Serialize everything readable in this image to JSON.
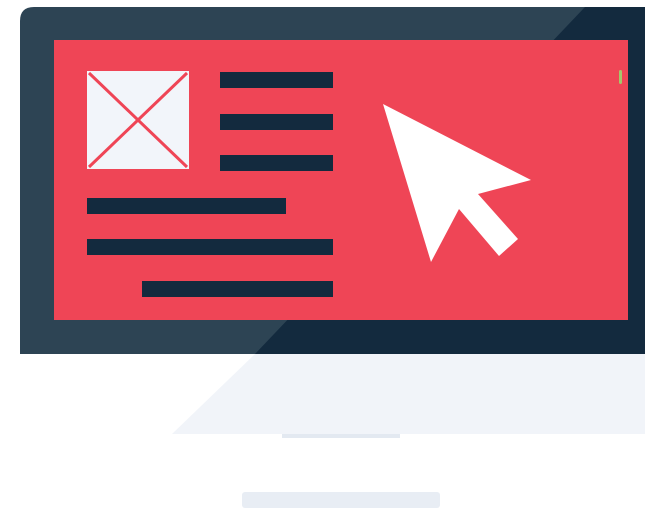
{
  "illustration": {
    "subject": "computer-monitor-with-cursor",
    "icons": {
      "image_placeholder": "image-placeholder-icon",
      "cursor": "mouse-pointer-icon"
    },
    "colors": {
      "bezel_left": "#2D4454",
      "bezel_right": "#132A3E",
      "screen": "#EF4556",
      "text_lines": "#132A3E",
      "image_box": "#F2F5FA",
      "cursor": "#FFFFFF",
      "chin": "#F1F4F9",
      "chin_shadow": "#FFFFFF",
      "stand": "#E3E9F1",
      "base": "#E8EDF4",
      "indicator": "#A5C66B"
    }
  }
}
